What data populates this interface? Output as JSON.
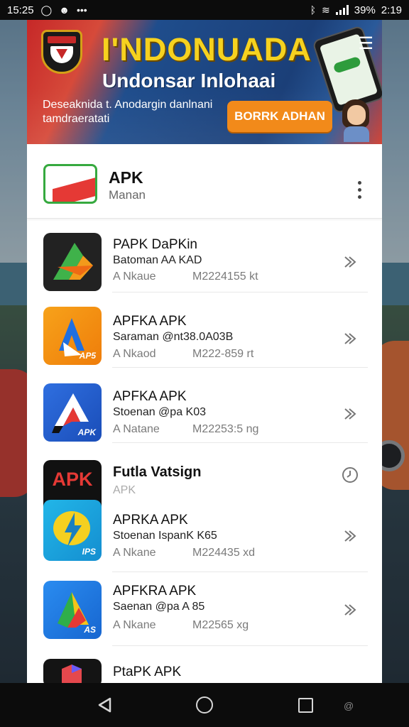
{
  "status_bar": {
    "time_left": "15:25",
    "battery": "39%",
    "time_right": "2:19",
    "left_icons": [
      "circle-icon",
      "emoji-icon",
      "more-dots-icon"
    ],
    "right_icons": [
      "bluetooth-icon",
      "wifi-icon",
      "signal-icon"
    ]
  },
  "banner": {
    "title": "I'NDONUADA",
    "subtitle": "Undonsar Inlohaai",
    "description": "Deseaknida t. Anodargin danlnani tamdraeratati",
    "cta_label": "BORRK ADHAN"
  },
  "header": {
    "title": "APK",
    "subtitle": "Manan"
  },
  "apps": [
    {
      "name": "PAPK DaPKin",
      "sub": "Batoman AA KAD",
      "meta_left": "A Nkaue",
      "meta_right": "M2224155 kt",
      "icon": "arrow-logo-icon",
      "icon_style": "ic-dark",
      "icon_label": ""
    },
    {
      "name": "APFKA APK",
      "sub": "Saraman @nt38.0A03B",
      "meta_left": "A Nkaod",
      "meta_right": "M222-859 rt",
      "icon": "pen-logo-icon",
      "icon_style": "ic-orange",
      "icon_label": "AP5"
    },
    {
      "name": "APFKA APK",
      "sub": "Stoenan @pa K03",
      "meta_left": "A Natane",
      "meta_right": "M22253:5 ng",
      "icon": "a-logo-icon",
      "icon_style": "ic-blue",
      "icon_label": "APK"
    },
    {
      "name": "Futla Vatsign",
      "sub": "APK",
      "meta_left": "",
      "meta_right": "",
      "icon": "apk-text-icon",
      "icon_style": "ic-black",
      "icon_label": "APK"
    },
    {
      "name": "APRKA APK",
      "sub": "Stoenan IspanK K65",
      "meta_left": "A Nkane",
      "meta_right": "M224435 xd",
      "icon": "bolt-logo-icon",
      "icon_style": "ic-cyan",
      "icon_label": "IPS"
    },
    {
      "name": "APFKRA APK",
      "sub": "Saenan @pa A 85",
      "meta_left": "A Nkane",
      "meta_right": "M22565 xg",
      "icon": "triangle-logo-icon",
      "icon_style": "ic-blue2",
      "icon_label": "AS"
    },
    {
      "name": "PtaPK APK",
      "sub": "",
      "meta_left": "",
      "meta_right": "",
      "icon": "cube-logo-icon",
      "icon_style": "ic-dark2",
      "icon_label": ""
    }
  ],
  "colors": {
    "banner_title": "#f6d21f",
    "cta": "#f28a1a",
    "header_green": "#36a93f",
    "header_red": "#e53935"
  }
}
